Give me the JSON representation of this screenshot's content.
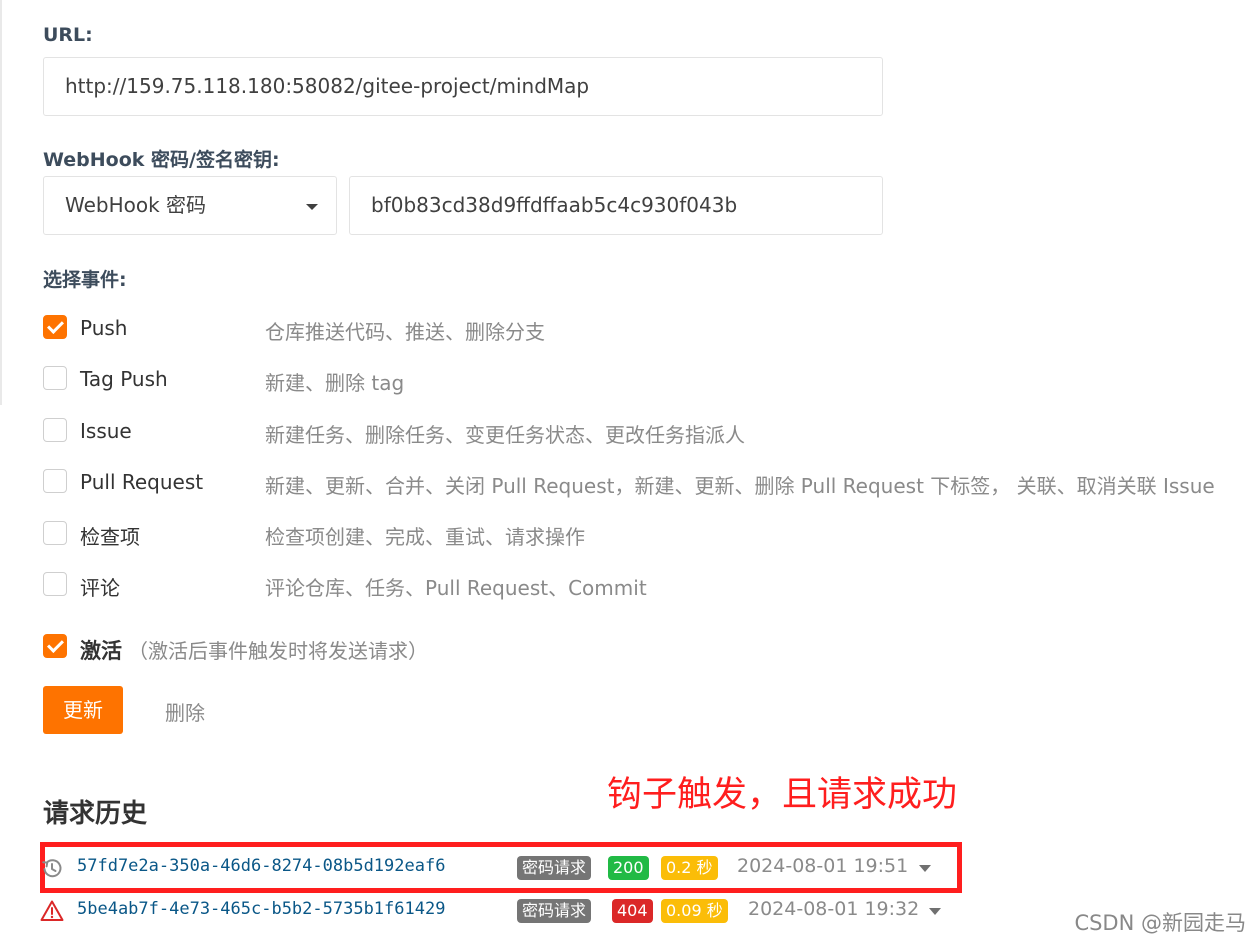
{
  "colors": {
    "accent": "#fe7300",
    "success": "#21ba45",
    "error": "#db2828",
    "warning": "#fbbd08",
    "annotation": "#ff1e1e"
  },
  "form": {
    "url_label": "URL:",
    "url_value": "http://159.75.118.180:58082/gitee-project/mindMap",
    "secret_label": "WebHook 密码/签名密钥:",
    "secret_type": "WebHook 密码",
    "secret_value": "bf0b83cd38d9ffdffaab5c4c930f043b",
    "events_label": "选择事件:",
    "events": [
      {
        "name": "Push",
        "desc": "仓库推送代码、推送、删除分支",
        "checked": true
      },
      {
        "name": "Tag Push",
        "desc": "新建、删除 tag",
        "checked": false
      },
      {
        "name": "Issue",
        "desc": "新建任务、删除任务、变更任务状态、更改任务指派人",
        "checked": false
      },
      {
        "name": "Pull Request",
        "desc": "新建、更新、合并、关闭 Pull Request，新建、更新、删除 Pull Request 下标签， 关联、取消关联 Issue",
        "checked": false
      },
      {
        "name": "检查项",
        "desc": "检查项创建、完成、重试、请求操作",
        "checked": false
      },
      {
        "name": "评论",
        "desc": "评论仓库、任务、Pull Request、Commit",
        "checked": false
      }
    ],
    "activate_label": "激活",
    "activate_hint": "（激活后事件触发时将发送请求）",
    "activate_checked": true,
    "update_button": "更新",
    "delete_button": "删除"
  },
  "annotation": "钩子触发，且请求成功",
  "history": {
    "title": "请求历史",
    "items": [
      {
        "icon": "history-clock-icon",
        "id": "57fd7e2a-350a-46d6-8274-08b5d192eaf6",
        "type": "密码请求",
        "status": "200",
        "duration": "0.2 秒",
        "time": "2024-08-01 19:51"
      },
      {
        "icon": "warning-triangle-icon",
        "id": "5be4ab7f-4e73-465c-b5b2-5735b1f61429",
        "type": "密码请求",
        "status": "404",
        "duration": "0.09 秒",
        "time": "2024-08-01 19:32"
      }
    ]
  },
  "watermark": "CSDN @新园走马"
}
